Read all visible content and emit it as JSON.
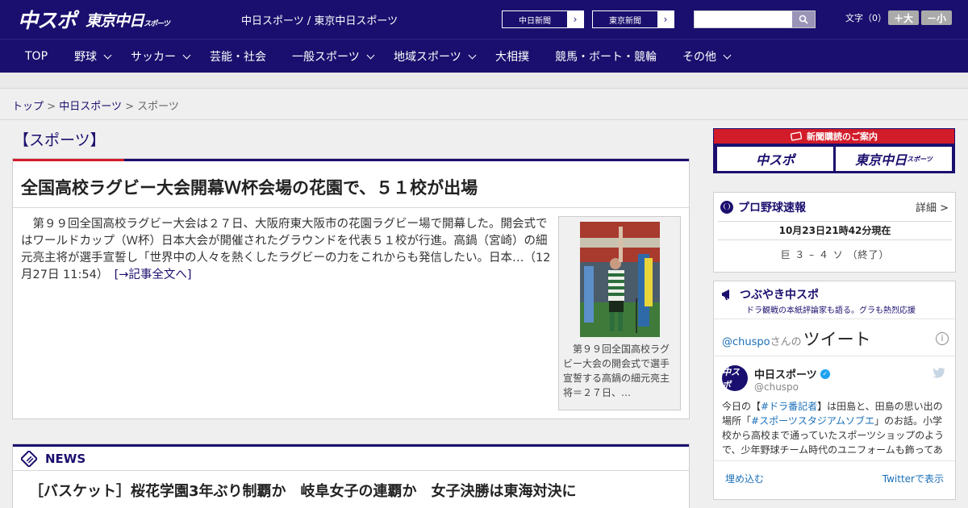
{
  "header": {
    "logo_main": "中スポ",
    "logo_sub": "東京中日",
    "logo_sub_small": "スポーツ",
    "site_title": "中日スポーツ / 東京中日スポーツ",
    "paper_buttons": [
      {
        "label": "中日新聞",
        "arrow": "›"
      },
      {
        "label": "東京新聞",
        "arrow": "›"
      }
    ],
    "search_placeholder": "",
    "font_size_label": "文字（0）",
    "font_plus": "＋大",
    "font_minus": "－小"
  },
  "nav": {
    "items": [
      {
        "label": "TOP",
        "dropdown": false
      },
      {
        "label": "野球",
        "dropdown": true
      },
      {
        "label": "サッカー",
        "dropdown": true
      },
      {
        "label": "芸能・社会",
        "dropdown": false
      },
      {
        "label": "一般スポーツ",
        "dropdown": true
      },
      {
        "label": "地域スポーツ",
        "dropdown": true
      },
      {
        "label": "大相撲",
        "dropdown": false
      },
      {
        "label": "競馬・ボート・競輪",
        "dropdown": false
      },
      {
        "label": "その他",
        "dropdown": true
      }
    ]
  },
  "breadcrumb": {
    "items": [
      "トップ",
      "中日スポーツ",
      "スポーツ"
    ],
    "separator": ">"
  },
  "section": {
    "title": "【スポーツ】"
  },
  "article": {
    "headline": "全国高校ラグビー大会開幕Ｗ杯会場の花園で、５１校が出場",
    "body": "第９９回全国高校ラグビー大会は２７日、大阪府東大阪市の花園ラグビー場で開幕した。開会式ではワールドカップ（Ｗ杯）日本大会が開催されたグラウンドを代表５１校が行進。高鍋（宮崎）の細元亮主将が選手宣誓し「世界中の人々を熱くしたラグビーの力をこれからも発信したい。日本…（12月27日 11:54）",
    "more_link": "[→記事全文へ]",
    "caption": "第９９回全国高校ラグビー大会の開会式で選手宣誓する高鍋の細元亮主将＝２７日、…"
  },
  "news": {
    "title": "NEWS",
    "items": [
      "［バスケット］桜花学園3年ぶり制覇か　岐阜女子の連覇か　女子決勝は東海対決に"
    ]
  },
  "sidebar": {
    "subscribe": {
      "title": "新聞購読のご案内",
      "logos": [
        "中スポ",
        "東京中日"
      ],
      "logo_small": "スポーツ"
    },
    "baseball": {
      "title": "プロ野球速報",
      "detail": "詳細 >",
      "time": "10月23日21時42分現在",
      "score": "巨 ３ – ４ ソ （終了）"
    },
    "twitter": {
      "title": "つぶやき中スポ",
      "subtitle": "ドラ観戦の本紙評論家も語る。グラも熱烈応援",
      "handle_at": "@chuspo",
      "handle_san": "さんの",
      "tweet_word": "ツイート",
      "info": "i",
      "avatar_text": "中スポ",
      "account_name": "中日スポーツ",
      "account_handle": "@chuspo",
      "body_pre": "今日の【",
      "tag1": "#ドラ番記者",
      "body_mid1": "】は田島と、田島の思い出の場所「",
      "tag2": "#スポーツスタジアムソブエ",
      "body_post": "」のお話。小学校から高校まで通っていたスポーツショップのようで、少年野球チーム時代のユニフォームも飾ってあります",
      "embed": "埋め込む",
      "view": "Twitterで表示"
    }
  },
  "colors": {
    "brand_navy": "#1a0f6e",
    "accent_red": "#d21c2a",
    "link_blue": "#1b6fb8"
  }
}
